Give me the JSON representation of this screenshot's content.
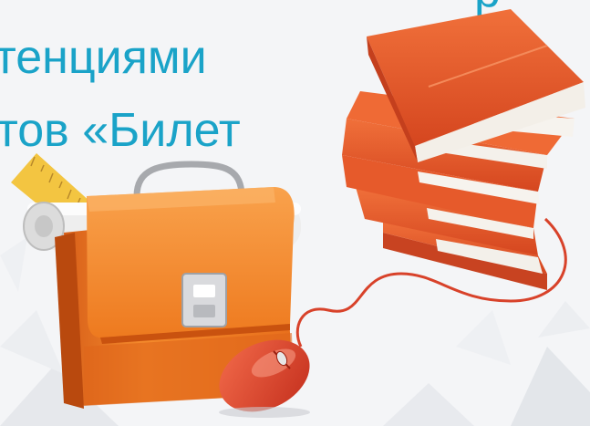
{
  "headline": {
    "line1": "р",
    "line2": "тенциями",
    "line3": "тов «Билет"
  },
  "colors": {
    "title_text": "#1aa3c8",
    "orange_light": "#f7a14a",
    "orange_main": "#ef7a1d",
    "orange_dark": "#c9520f",
    "book_red": "#e2582a",
    "cable_red": "#d8422a",
    "background": "#f4f5f7"
  },
  "icons": [
    "briefcase-icon",
    "book-stack-icon",
    "computer-mouse-icon",
    "ruler-icon",
    "paper-roll-icon"
  ]
}
